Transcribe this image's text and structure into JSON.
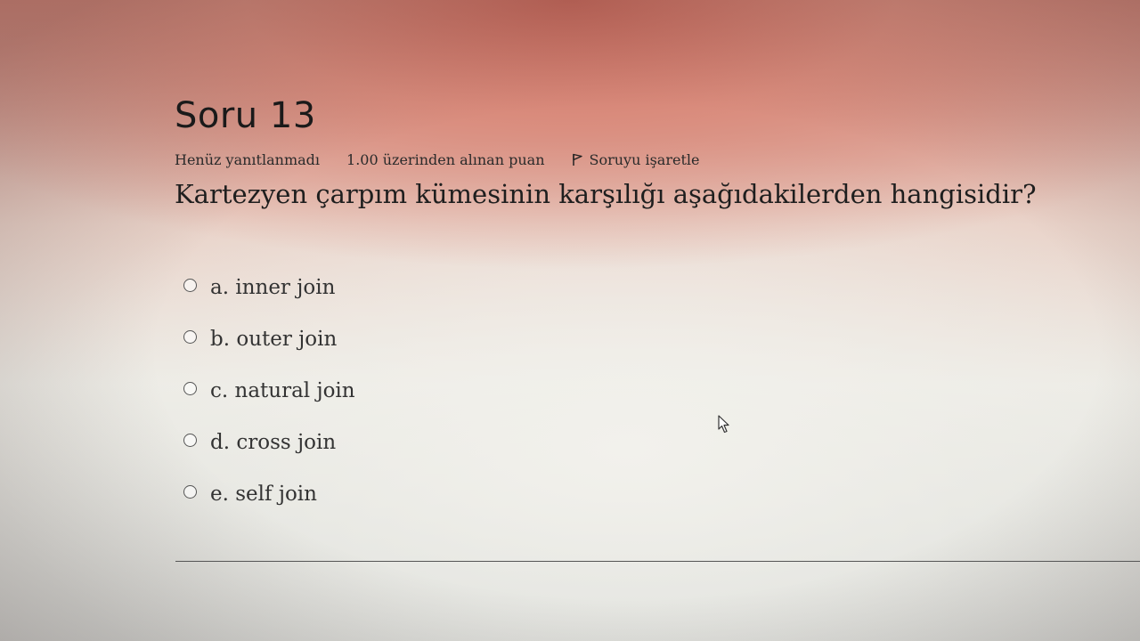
{
  "question": {
    "title": "Soru 13",
    "status": "Henüz yanıtlanmadı",
    "grade": "1.00 üzerinden alınan puan",
    "flag_label": "Soruyu işaretle",
    "text": "Kartezyen çarpım kümesinin karşılığı aşağıdakilerden hangisidir?"
  },
  "answers": [
    {
      "label": "a. inner join",
      "selected": false
    },
    {
      "label": "b. outer join",
      "selected": false
    },
    {
      "label": "c. natural join",
      "selected": false
    },
    {
      "label": "d. cross join",
      "selected": false
    },
    {
      "label": "e. self join",
      "selected": false
    }
  ],
  "icons": {
    "flag": "flag-icon",
    "cursor": "mouse-pointer-icon"
  }
}
